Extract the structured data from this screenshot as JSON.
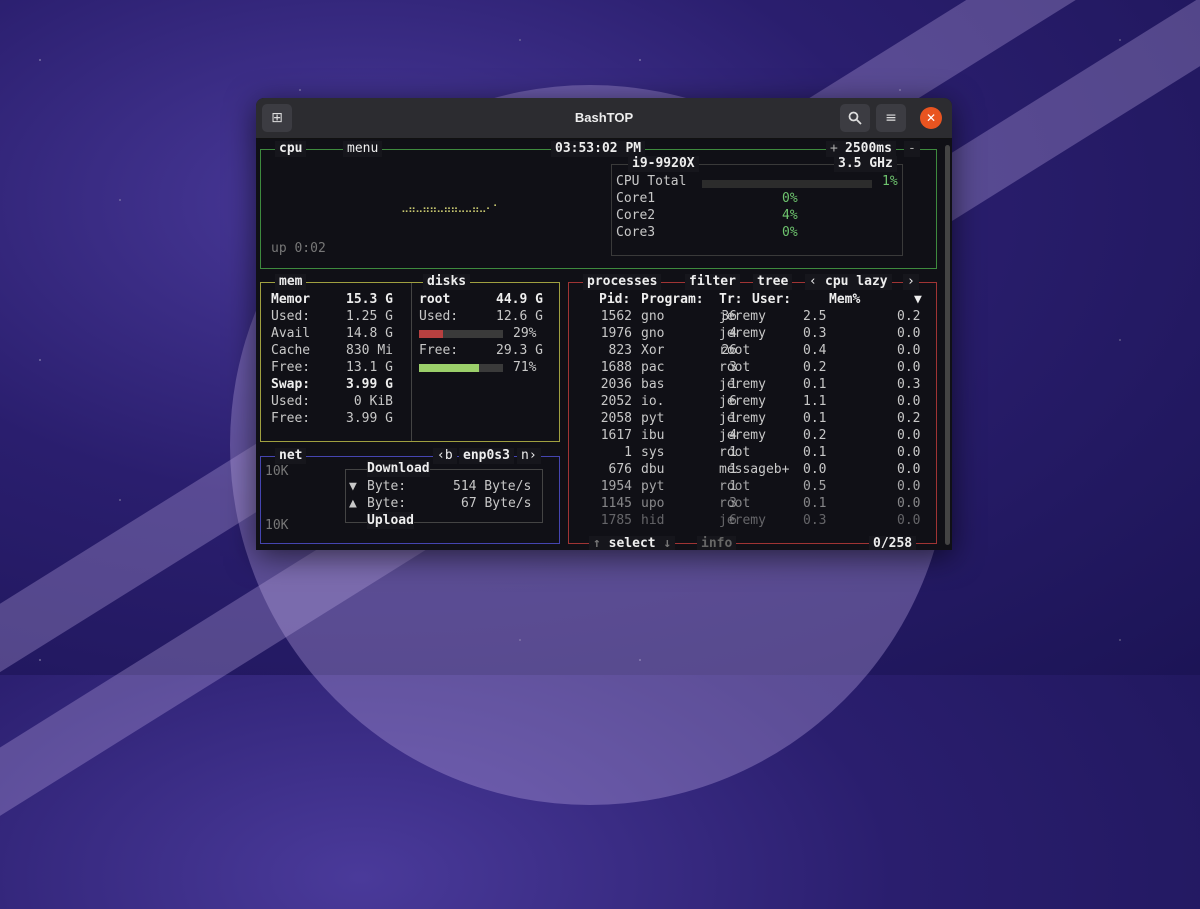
{
  "window": {
    "title": "BashTOP"
  },
  "cpu": {
    "tab_cpu": "cpu",
    "tab_menu": "menu",
    "clock": "03:53:02 PM",
    "interval": "2500ms",
    "interval_plus": "+",
    "interval_minus": "-",
    "model": "i9-9920X",
    "freq": "3.5 GHz",
    "uptime": "up 0:02",
    "total_label": "CPU Total",
    "total_value": "1%",
    "cores": [
      {
        "label": "Core1",
        "value": "0%"
      },
      {
        "label": "Core2",
        "value": "4%"
      },
      {
        "label": "Core3",
        "value": "0%"
      }
    ]
  },
  "mem": {
    "tab_mem": "mem",
    "tab_disks": "disks",
    "rows": [
      {
        "label": "Memor",
        "value": "15.3 G"
      },
      {
        "label": "Used:",
        "value": "1.25 G"
      },
      {
        "label": "Avail",
        "value": "14.8 G"
      },
      {
        "label": "Cache",
        "value": "830 Mi"
      },
      {
        "label": "Free:",
        "value": "13.1 G"
      },
      {
        "label": "Swap:",
        "value": "3.99 G"
      },
      {
        "label": "Used:",
        "value": "0 KiB"
      },
      {
        "label": "Free:",
        "value": "3.99 G"
      }
    ],
    "disk": {
      "name": "root",
      "total": "44.9 G",
      "used_label": "Used:",
      "used_value": "12.6 G",
      "used_pct": "29%",
      "free_label": "Free:",
      "free_value": "29.3 G",
      "free_pct": "71%"
    }
  },
  "net": {
    "tab_net": "net",
    "iface_prev": "‹b",
    "iface": "enp0s3",
    "iface_next": "n›",
    "scale_top": "10K",
    "scale_bottom": "10K",
    "download_label": "Download",
    "upload_label": "Upload",
    "down_arrow": "▼",
    "up_arrow": "▲",
    "down_unit": "Byte:",
    "down_value": "514 Byte/s",
    "up_unit": "Byte:",
    "up_value": "67 Byte/s"
  },
  "processes": {
    "tab_processes": "processes",
    "tab_filter": "filter",
    "tab_tree": "tree",
    "sort_prev": "‹",
    "sort": "cpu lazy",
    "sort_next": "›",
    "headers": {
      "pid": "Pid:",
      "program": "Program:",
      "tr": "Tr:",
      "user": "User:",
      "mem": "Mem%",
      "arrow": "▼"
    },
    "rows": [
      {
        "pid": "1562",
        "prog": "gno",
        "tr": "36",
        "user": "jeremy",
        "mem": "2.5",
        "cpu": "0.2"
      },
      {
        "pid": "1976",
        "prog": "gno",
        "tr": "4",
        "user": "jeremy",
        "mem": "0.3",
        "cpu": "0.0"
      },
      {
        "pid": "823",
        "prog": "Xor",
        "tr": "26",
        "user": "root",
        "mem": "0.4",
        "cpu": "0.0"
      },
      {
        "pid": "1688",
        "prog": "pac",
        "tr": "3",
        "user": "root",
        "mem": "0.2",
        "cpu": "0.0"
      },
      {
        "pid": "2036",
        "prog": "bas",
        "tr": "1",
        "user": "jeremy",
        "mem": "0.1",
        "cpu": "0.3"
      },
      {
        "pid": "2052",
        "prog": "io.",
        "tr": "6",
        "user": "jeremy",
        "mem": "1.1",
        "cpu": "0.0"
      },
      {
        "pid": "2058",
        "prog": "pyt",
        "tr": "1",
        "user": "jeremy",
        "mem": "0.1",
        "cpu": "0.2"
      },
      {
        "pid": "1617",
        "prog": "ibu",
        "tr": "4",
        "user": "jeremy",
        "mem": "0.2",
        "cpu": "0.0"
      },
      {
        "pid": "1",
        "prog": "sys",
        "tr": "1",
        "user": "root",
        "mem": "0.1",
        "cpu": "0.0"
      },
      {
        "pid": "676",
        "prog": "dbu",
        "tr": "1",
        "user": "messageb+",
        "mem": "0.0",
        "cpu": "0.0"
      },
      {
        "pid": "1954",
        "prog": "pyt",
        "tr": "1",
        "user": "root",
        "mem": "0.5",
        "cpu": "0.0"
      },
      {
        "pid": "1145",
        "prog": "upo",
        "tr": "3",
        "user": "root",
        "mem": "0.1",
        "cpu": "0.0"
      },
      {
        "pid": "1785",
        "prog": "hid",
        "tr": "6",
        "user": "jeremy",
        "mem": "0.3",
        "cpu": "0.0"
      }
    ],
    "select_label": "select",
    "info_label": "info",
    "count": "0/258"
  },
  "colors": {
    "cpu_border": "#3e8a3e",
    "mem_border": "#a0a040",
    "net_border": "#4545b0",
    "proc_border": "#a03434",
    "close_button": "#e95420"
  }
}
